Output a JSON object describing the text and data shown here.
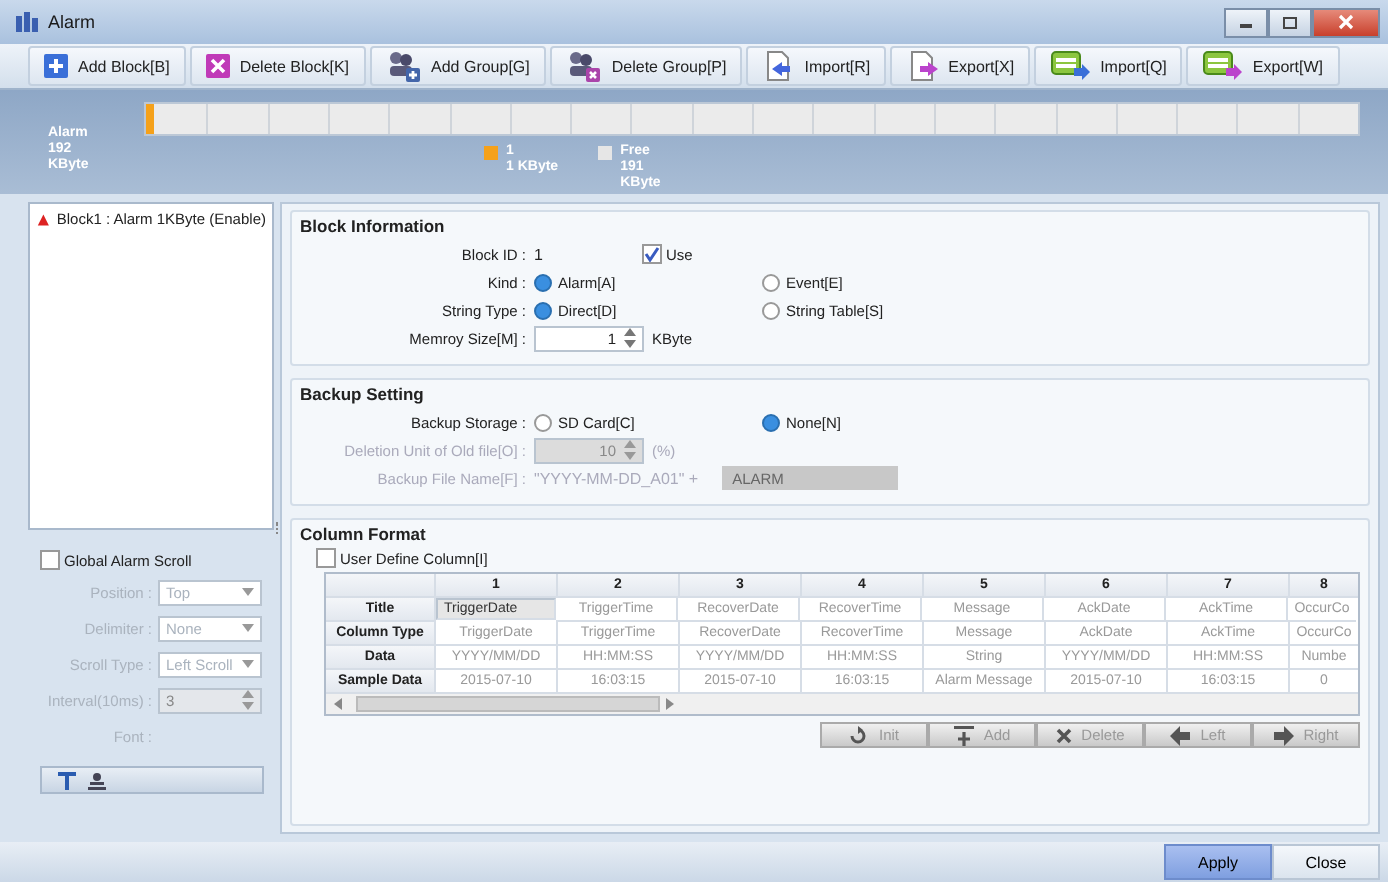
{
  "window": {
    "title": "Alarm"
  },
  "toolbar": [
    {
      "label": "Add Block[B]",
      "kind": "add-block"
    },
    {
      "label": "Delete Block[K]",
      "kind": "delete-block"
    },
    {
      "label": "Add Group[G]",
      "kind": "add-group"
    },
    {
      "label": "Delete Group[P]",
      "kind": "delete-group"
    },
    {
      "label": "Import[R]",
      "kind": "import"
    },
    {
      "label": "Export[X]",
      "kind": "export"
    },
    {
      "label": "Import[Q]",
      "kind": "csv-import"
    },
    {
      "label": "Export[W]",
      "kind": "csv-export"
    }
  ],
  "memory": {
    "lines": [
      "Alarm",
      "192",
      "KByte"
    ],
    "level": 0.006,
    "legend": [
      {
        "lines": [
          "1",
          "1 KByte"
        ],
        "color": "#f5a11a"
      },
      {
        "lines": [
          "Free",
          "191",
          "KByte"
        ],
        "color": "#e6e6e6"
      }
    ]
  },
  "tree": [
    {
      "label": "Block1 : Alarm  1KByte (Enable)"
    }
  ],
  "scroll": {
    "checkbox": {
      "label": "Global Alarm Scroll",
      "checked": false
    },
    "disabled": true,
    "fields": [
      {
        "label": "Position :",
        "value": "Top",
        "kind": "select"
      },
      {
        "label": "Delimiter :",
        "value": "None",
        "kind": "select"
      },
      {
        "label": "Scroll Type :",
        "value": "Left Scroll",
        "kind": "select"
      },
      {
        "label": "Interval(10ms) :",
        "value": "3",
        "kind": "spin"
      },
      {
        "label": "Font :",
        "kind": "label"
      }
    ]
  },
  "block_info": {
    "title": "Block Information",
    "block_id": {
      "label": "Block ID :",
      "value": "1"
    },
    "use": {
      "label": "Use",
      "checked": true
    },
    "radios": [
      {
        "label": "Kind :",
        "options": [
          {
            "label": "Alarm[A]",
            "selected": true
          },
          {
            "label": "Event[E]",
            "selected": false
          }
        ]
      },
      {
        "label": "String Type :",
        "options": [
          {
            "label": "Direct[D]",
            "selected": true
          },
          {
            "label": "String Table[S]",
            "selected": false
          }
        ]
      }
    ],
    "memory_size": {
      "label": "Memroy Size[M] :",
      "value": "1",
      "unit": "KByte"
    }
  },
  "backup": {
    "title": "Backup Setting",
    "storage": {
      "label": "Backup Storage :",
      "options": [
        {
          "label": "SD Card[C]",
          "selected": false
        },
        {
          "label": "None[N]",
          "selected": true
        }
      ]
    },
    "deletion": {
      "label": "Deletion  Unit of Old file[O] :",
      "value": "10",
      "unit": "(%)",
      "disabled": true
    },
    "file_name": {
      "label": "Backup File Name[F] :",
      "prefix": "\"YYYY-MM-DD_A01\" +",
      "value": "ALARM",
      "disabled": true
    }
  },
  "column_format": {
    "title": "Column Format",
    "user_define": {
      "label": "User Define Column[I]",
      "checked": false
    },
    "columns": [
      "1",
      "2",
      "3",
      "4",
      "5",
      "6",
      "7",
      "8"
    ],
    "rows": [
      {
        "header": "Title",
        "cells": [
          {
            "text": "TriggerDate",
            "selected": true
          },
          {
            "text": "TriggerTime",
            "selected": false
          },
          {
            "text": "RecoverDate",
            "selected": false
          },
          {
            "text": "RecoverTime",
            "selected": false
          },
          {
            "text": "Message",
            "selected": false
          },
          {
            "text": "AckDate",
            "selected": false
          },
          {
            "text": "AckTime",
            "selected": false
          },
          {
            "text": "OccurCo",
            "selected": false
          }
        ]
      },
      {
        "header": "Column Type",
        "cells": [
          {
            "text": "TriggerDate",
            "selected": false
          },
          {
            "text": "TriggerTime",
            "selected": false
          },
          {
            "text": "RecoverDate",
            "selected": false
          },
          {
            "text": "RecoverTime",
            "selected": false
          },
          {
            "text": "Message",
            "selected": false
          },
          {
            "text": "AckDate",
            "selected": false
          },
          {
            "text": "AckTime",
            "selected": false
          },
          {
            "text": "OccurCo",
            "selected": false
          }
        ]
      },
      {
        "header": "Data",
        "cells": [
          {
            "text": "YYYY/MM/DD",
            "selected": false
          },
          {
            "text": "HH:MM:SS",
            "selected": false
          },
          {
            "text": "YYYY/MM/DD",
            "selected": false
          },
          {
            "text": "HH:MM:SS",
            "selected": false
          },
          {
            "text": "String",
            "selected": false
          },
          {
            "text": "YYYY/MM/DD",
            "selected": false
          },
          {
            "text": "HH:MM:SS",
            "selected": false
          },
          {
            "text": "Numbe",
            "selected": false
          }
        ]
      },
      {
        "header": "Sample Data",
        "cells": [
          {
            "text": "2015-07-10",
            "selected": false
          },
          {
            "text": "16:03:15",
            "selected": false
          },
          {
            "text": "2015-07-10",
            "selected": false
          },
          {
            "text": "16:03:15",
            "selected": false
          },
          {
            "text": "Alarm Message",
            "selected": false
          },
          {
            "text": "2015-07-10",
            "selected": false
          },
          {
            "text": "16:03:15",
            "selected": false
          },
          {
            "text": "0",
            "selected": false
          }
        ]
      }
    ],
    "buttons": [
      {
        "label": "Init",
        "kind": "init",
        "disabled": true
      },
      {
        "label": "Add",
        "kind": "add",
        "disabled": true
      },
      {
        "label": "Delete",
        "kind": "delete",
        "disabled": true
      },
      {
        "label": "Left",
        "kind": "left",
        "disabled": true
      },
      {
        "label": "Right",
        "kind": "right",
        "disabled": true
      }
    ]
  },
  "footer": [
    {
      "label": "Apply",
      "kind": "primary"
    },
    {
      "label": "Close",
      "kind": "normal"
    }
  ]
}
